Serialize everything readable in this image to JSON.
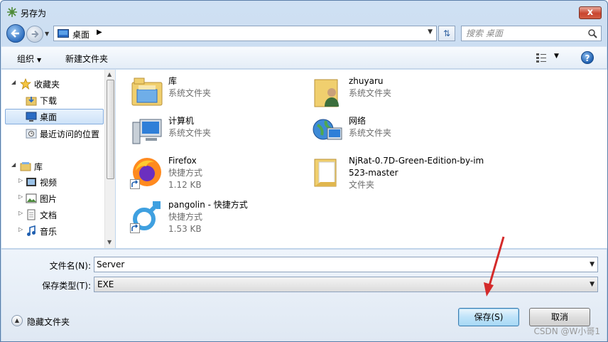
{
  "window": {
    "title": "另存为",
    "close_label": "x"
  },
  "address_bar": {
    "location": "桌面",
    "search_placeholder": "搜索 桌面"
  },
  "toolbar": {
    "organize": "组织",
    "new_folder": "新建文件夹",
    "help": "?"
  },
  "nav": {
    "favorites": {
      "label": "收藏夹",
      "items": [
        "下载",
        "桌面",
        "最近访问的位置"
      ]
    },
    "libraries": {
      "label": "库",
      "items": [
        "视频",
        "图片",
        "文档",
        "音乐"
      ]
    }
  },
  "files": [
    {
      "name": "库",
      "type": "系统文件夹",
      "icon": "library-icon"
    },
    {
      "name": "zhuyaru",
      "type": "系统文件夹",
      "icon": "user-folder-icon"
    },
    {
      "name": "计算机",
      "type": "系统文件夹",
      "icon": "computer-icon"
    },
    {
      "name": "网络",
      "type": "系统文件夹",
      "icon": "network-icon"
    },
    {
      "name": "Firefox",
      "type": "快捷方式",
      "size": "1.12 KB",
      "icon": "firefox-icon"
    },
    {
      "name_line1": "NjRat-0.7D-Green-Edition-by-im",
      "name_line2": "523-master",
      "type": "文件夹",
      "icon": "folder-icon"
    },
    {
      "name": "pangolin - 快捷方式",
      "type": "快捷方式",
      "size": "1.53 KB",
      "icon": "pangolin-icon"
    }
  ],
  "form": {
    "filename_label": "文件名(N):",
    "filename_value": "Server",
    "filetype_label": "保存类型(T):",
    "filetype_value": "EXE"
  },
  "footer": {
    "hide_folders": "隐藏文件夹",
    "save": "保存(S)",
    "cancel": "取消"
  },
  "watermark": "CSDN @W小哥1",
  "colors": {
    "accent": "#3c7fb1",
    "annotation_arrow": "#d42a2a"
  }
}
